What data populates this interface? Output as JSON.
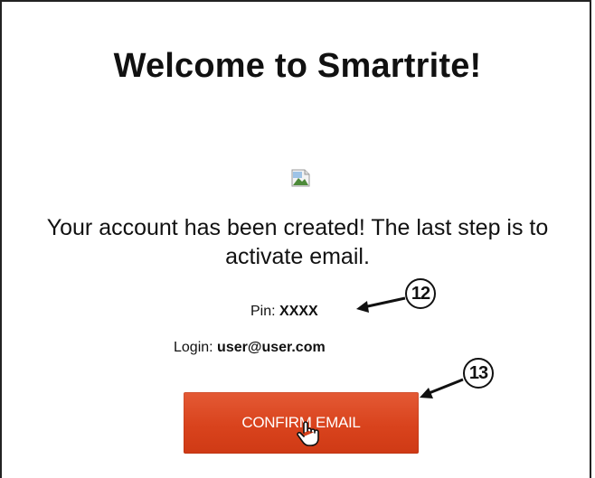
{
  "page": {
    "title": "Welcome to Smartrite!",
    "message": "Your account has been created! The last step is to activate email.",
    "pin_label": "Pin: ",
    "pin_value": "XXXX",
    "login_label": "Login: ",
    "login_value": "user@user.com",
    "button_label": "CONFIRM EMAIL",
    "button_color": "#d9431d"
  },
  "annotations": [
    {
      "number": "12",
      "target": "pin"
    },
    {
      "number": "13",
      "target": "confirm-email-button"
    }
  ],
  "icons": {
    "broken_image": "broken-image-icon",
    "cursor": "hand-pointer-icon"
  }
}
